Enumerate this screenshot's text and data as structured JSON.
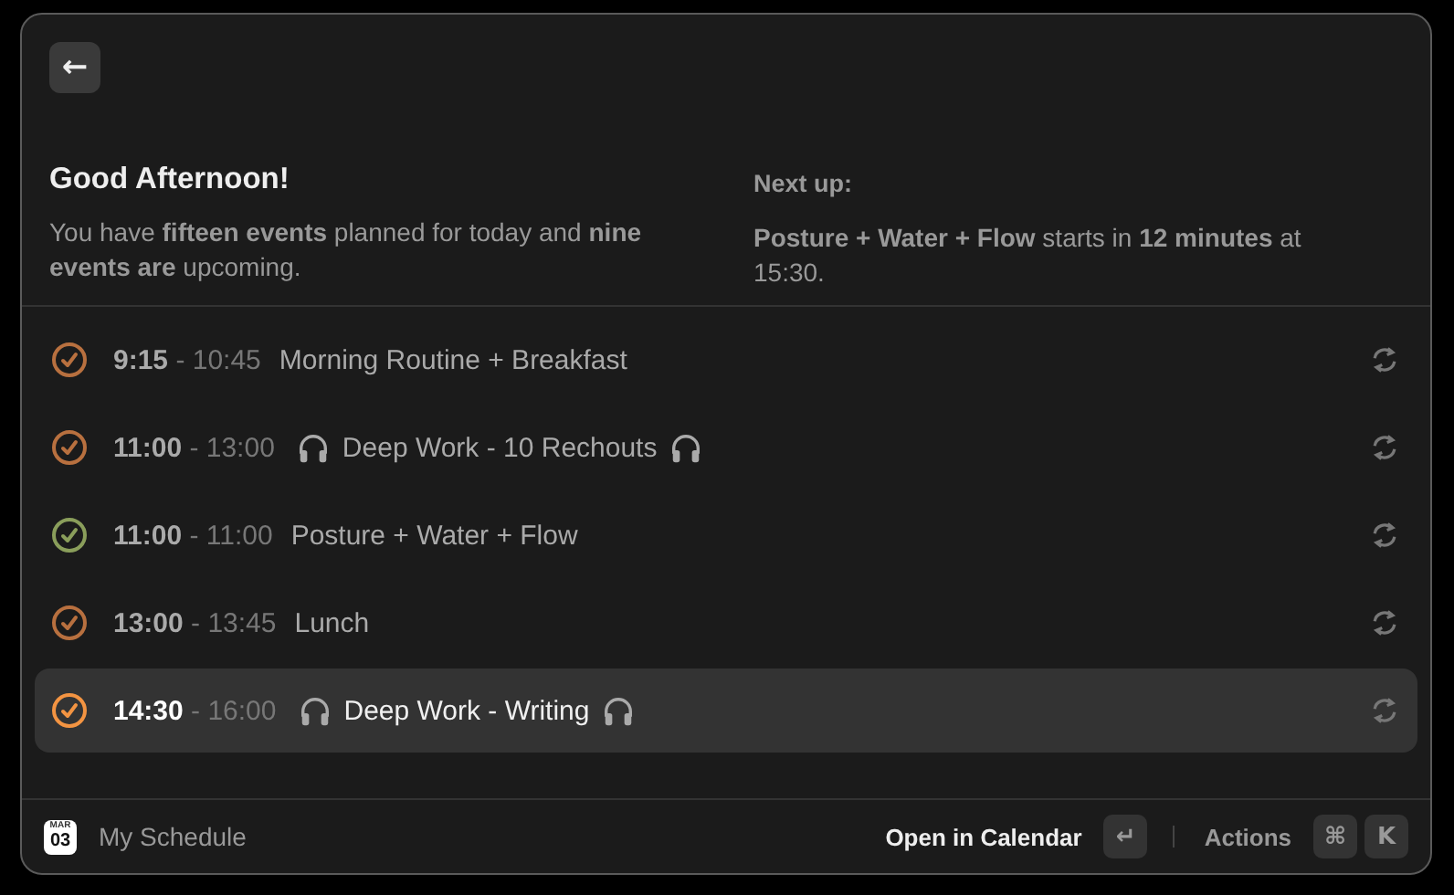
{
  "back_button": {
    "label": "←"
  },
  "greeting": {
    "title": "Good Afternoon!",
    "summary": "You have **fifteen events** planned for today and **nine events are** upcoming."
  },
  "next_up": {
    "label": "Next up:",
    "text": "**Posture + Water + Flow** starts in **12 minutes** at 15:30."
  },
  "events": [
    {
      "start": "9:15",
      "separator": "-",
      "end": "10:45",
      "title": "Morning Routine + Breakfast",
      "headphones": false,
      "color": "#b8703f",
      "selected": false
    },
    {
      "start": "11:00",
      "separator": "-",
      "end": "13:00",
      "title": "Deep Work - 10 Rechouts",
      "headphones": true,
      "color": "#b8703f",
      "selected": false
    },
    {
      "start": "11:00",
      "separator": "-",
      "end": "11:00",
      "title": "Posture + Water + Flow",
      "headphones": false,
      "color": "#8a9e5b",
      "selected": false
    },
    {
      "start": "13:00",
      "separator": "-",
      "end": "13:45",
      "title": "Lunch",
      "headphones": false,
      "color": "#b8703f",
      "selected": false
    },
    {
      "start": "14:30",
      "separator": "-",
      "end": "16:00",
      "title": "Deep Work - Writing",
      "headphones": true,
      "color": "#f39442",
      "selected": true
    }
  ],
  "footer": {
    "calendar_month": "MAR",
    "calendar_day": "03",
    "title": "My Schedule",
    "primary_action": "Open in Calendar",
    "primary_key": "↵",
    "actions_label": "Actions",
    "action_keys": [
      "⌘",
      "K"
    ]
  }
}
